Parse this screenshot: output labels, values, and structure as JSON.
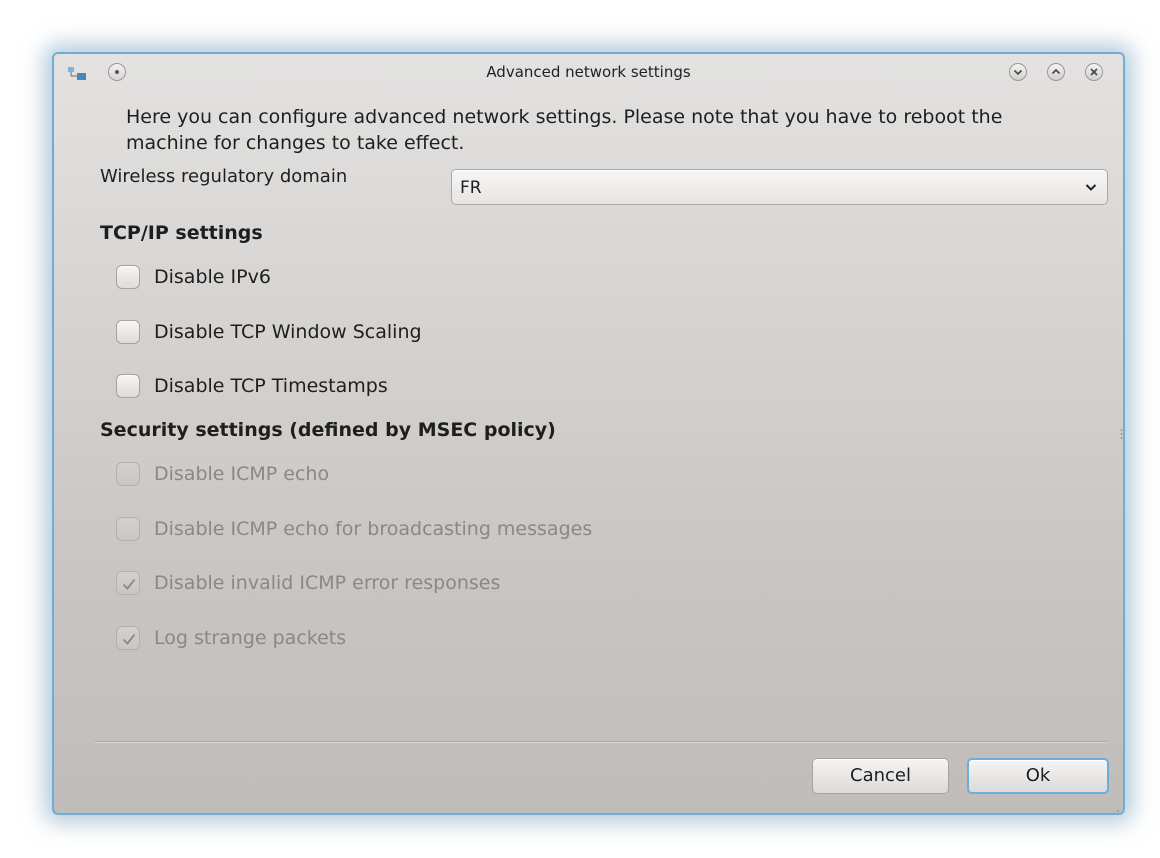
{
  "window": {
    "title": "Advanced network settings",
    "accent_color": "#6aaed9"
  },
  "titlebar": {
    "app_icon": "network-app-icon",
    "menu_icon": "window-menu-icon",
    "minimize_icon": "minimize-icon",
    "maximize_icon": "maximize-icon",
    "close_icon": "close-icon"
  },
  "intro_text": "Here you can configure advanced network settings. Please note that you have to reboot the machine for changes to take effect.",
  "wireless": {
    "label": "Wireless regulatory domain",
    "selected": "FR",
    "dropdown_icon": "chevron-down-icon"
  },
  "tcpip": {
    "title": "TCP/IP settings",
    "options": [
      {
        "label": "Disable IPv6",
        "checked": false,
        "enabled": true
      },
      {
        "label": "Disable TCP Window Scaling",
        "checked": false,
        "enabled": true
      },
      {
        "label": "Disable TCP Timestamps",
        "checked": false,
        "enabled": true
      }
    ]
  },
  "security": {
    "title": "Security settings (defined by MSEC policy)",
    "options": [
      {
        "label": "Disable ICMP echo",
        "checked": false,
        "enabled": false
      },
      {
        "label": "Disable ICMP echo for broadcasting messages",
        "checked": false,
        "enabled": false
      },
      {
        "label": "Disable invalid ICMP error responses",
        "checked": true,
        "enabled": false
      },
      {
        "label": "Log strange packets",
        "checked": true,
        "enabled": false
      }
    ]
  },
  "buttons": {
    "cancel": "Cancel",
    "ok": "Ok"
  }
}
